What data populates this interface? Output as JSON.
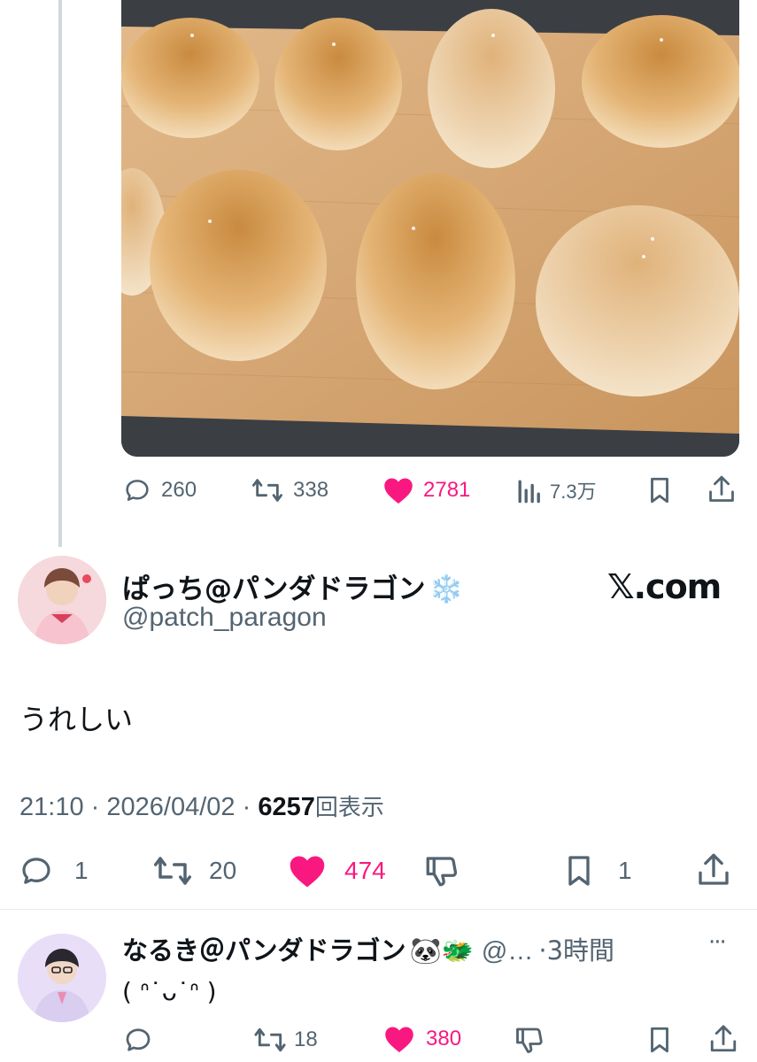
{
  "previous_tweet": {
    "photo_alt": "bread rolls on a wooden board",
    "stats": {
      "replies": "260",
      "retweets": "338",
      "likes": "2781",
      "views": "7.3万"
    }
  },
  "main_tweet": {
    "display_name": "ぱっち@パンダドラゴン",
    "name_emoji": "❄️",
    "handle": "@patch_paragon",
    "brand": "𝕏.com",
    "text": "うれしい",
    "time": "21:10",
    "date": "2026/04/02",
    "views_count": "6257",
    "views_label": "回表示",
    "sep": "·",
    "stats": {
      "replies": "1",
      "retweets": "20",
      "likes": "474",
      "bookmarks": "1"
    }
  },
  "reply_tweet": {
    "display_name": "なるき＠パンダドラゴン",
    "name_emoji": "🐼🐲",
    "handle": "@…",
    "time": "3時間",
    "text": "( ᐢ˙ᴗ˙ᐢ )",
    "more": "···",
    "stats": {
      "retweets": "18",
      "likes": "380"
    }
  },
  "colors": {
    "like_pink": "#f91880",
    "icon_gray": "#536471",
    "thread_line": "#cfd9de"
  }
}
